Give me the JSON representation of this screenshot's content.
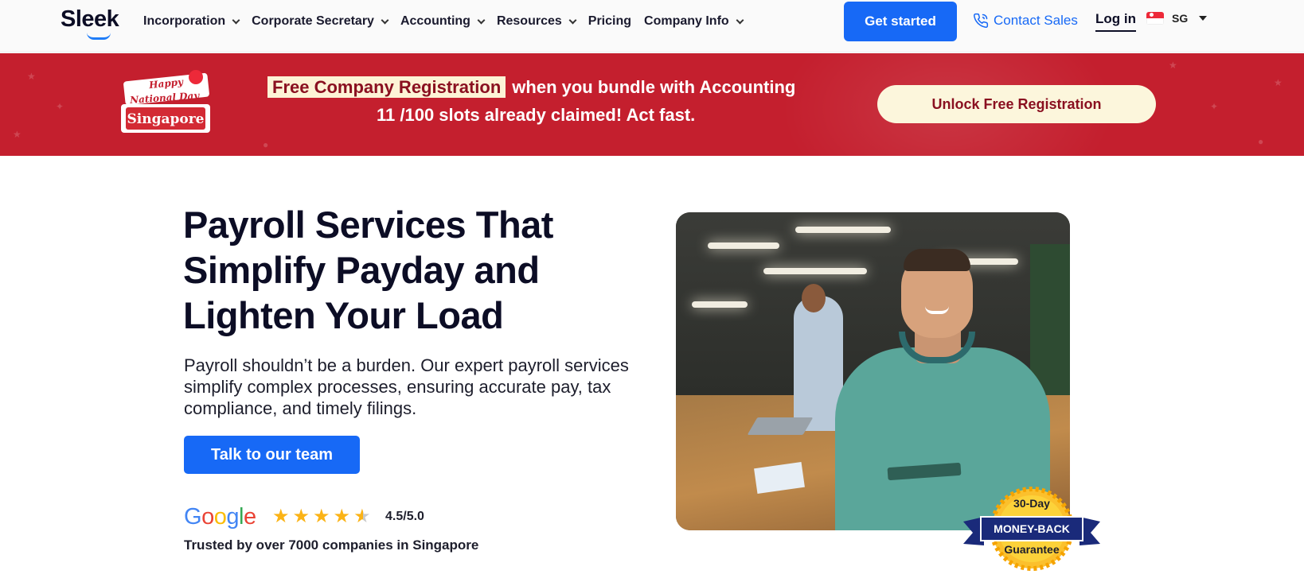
{
  "nav": {
    "logo": "Sleek",
    "items": [
      {
        "label": "Incorporation",
        "has_dropdown": true
      },
      {
        "label": "Corporate Secretary",
        "has_dropdown": true
      },
      {
        "label": "Accounting",
        "has_dropdown": true
      },
      {
        "label": "Resources",
        "has_dropdown": true
      },
      {
        "label": "Pricing",
        "has_dropdown": false
      },
      {
        "label": "Company Info",
        "has_dropdown": true
      }
    ],
    "get_started": "Get started",
    "contact_sales": "Contact Sales",
    "login": "Log in",
    "locale": "SG"
  },
  "banner": {
    "badge": {
      "line1": "Happy",
      "line2": "National Day",
      "line3": "Singapore"
    },
    "highlight": "Free Company Registration",
    "line1_rest": "when you bundle with Accounting",
    "line2": "11 /100 slots already claimed! Act fast.",
    "cta": "Unlock Free Registration"
  },
  "hero": {
    "title": "Payroll Services That Simplify Payday and Lighten Your Load",
    "description": "Payroll shouldn’t be a burden. Our expert payroll services simplify complex processes, ensuring accurate pay, tax compliance, and timely filings.",
    "cta": "Talk to our team",
    "rating_source": "Google",
    "rating_value": 4.5,
    "rating_text": "4.5/5.0",
    "trusted": "Trusted by over 7000 companies in Singapore"
  },
  "seal": {
    "line1": "30-Day",
    "line2": "MONEY-BACK",
    "line3": "Guarantee"
  },
  "colors": {
    "primary": "#1769f6",
    "banner": "#c41f2e",
    "highlight_bg": "#fdf3d6",
    "seal_navy": "#1a2a7a",
    "seal_gold": "#fbc02d"
  }
}
